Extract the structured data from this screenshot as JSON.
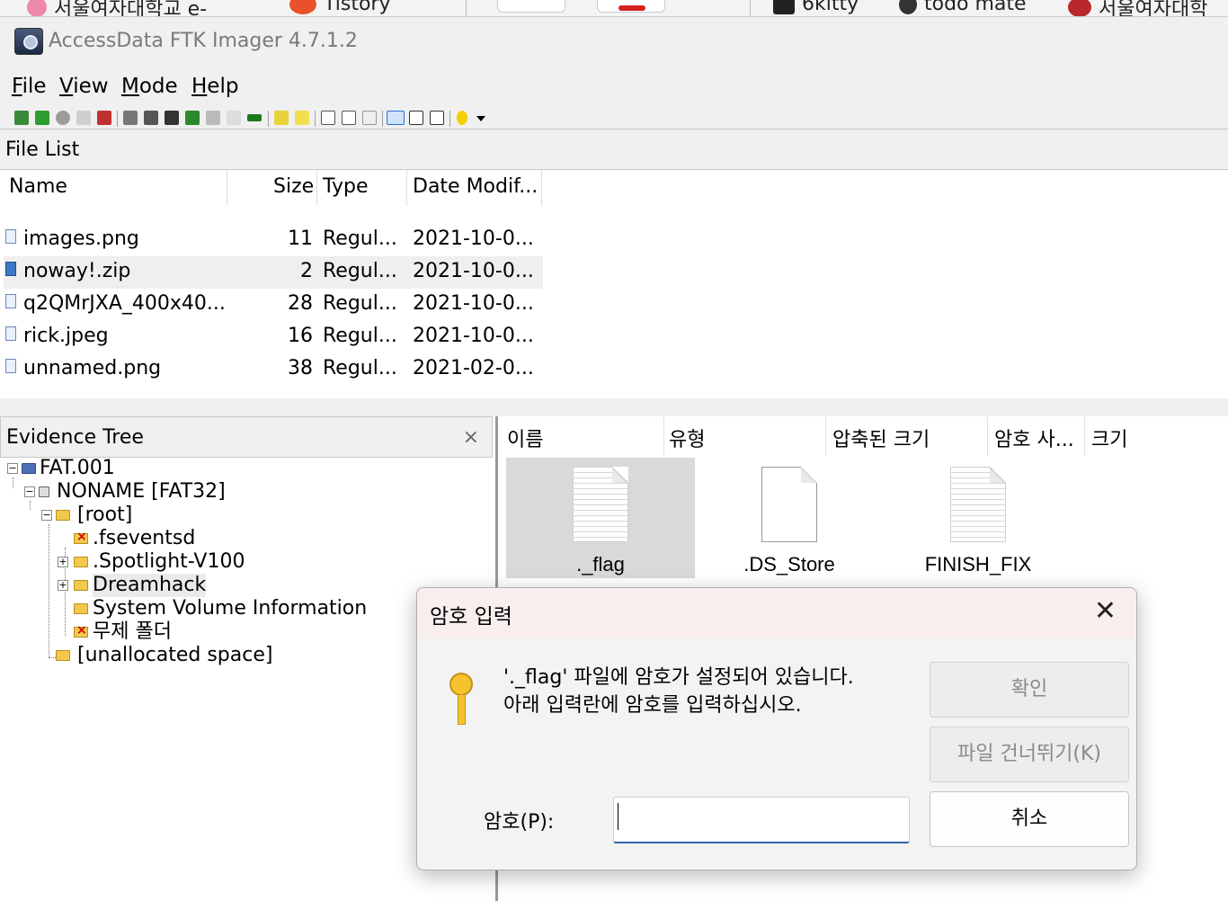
{
  "background_tabs": [
    "서울여자대학교 e-",
    "Tistory",
    "6kitty",
    "todo mate",
    "서울여자대학"
  ],
  "window": {
    "title": "AccessData FTK Imager 4.7.1.2"
  },
  "menu": {
    "items": [
      {
        "label": "File",
        "accel": "F"
      },
      {
        "label": "View",
        "accel": "V"
      },
      {
        "label": "Mode",
        "accel": "M"
      },
      {
        "label": "Help",
        "accel": "H"
      }
    ]
  },
  "toolbar": {
    "icons": [
      "add-evidence-icon",
      "add-all-evidence-icon",
      "image-mounting-icon",
      "remove-evidence-icon",
      "remove-all-evidence-icon",
      "create-image-icon",
      "export-disk-image-icon",
      "export-logical-image-icon",
      "capture-memory-icon",
      "obtain-protected-files-icon",
      "detect-encryption-icon",
      "ram-icon",
      "export-files-icon",
      "export-hash-list-icon",
      "export-directory-listing-icon",
      "file-icon",
      "properties-icon",
      "hex-value-icon",
      "auto-view-icon",
      "text-view-icon",
      "hex-view-icon",
      "help-icon",
      "dropdown-icon"
    ]
  },
  "file_list": {
    "title": "File List",
    "columns": [
      "Name",
      "Size",
      "Type",
      "Date Modif..."
    ],
    "rows": [
      {
        "name": "images.png",
        "size": "11",
        "type": "Regul...",
        "date": "2021-10-0..."
      },
      {
        "name": "noway!.zip",
        "size": "2",
        "type": "Regul...",
        "date": "2021-10-0..."
      },
      {
        "name": "q2QMrJXA_400x40...",
        "size": "28",
        "type": "Regul...",
        "date": "2021-10-0..."
      },
      {
        "name": "rick.jpeg",
        "size": "16",
        "type": "Regul...",
        "date": "2021-10-0..."
      },
      {
        "name": "unnamed.png",
        "size": "38",
        "type": "Regul...",
        "date": "2021-02-0..."
      }
    ]
  },
  "evidence_tree": {
    "title": "Evidence Tree",
    "close": "×",
    "nodes": [
      {
        "label": "FAT.001"
      },
      {
        "label": "NONAME [FAT32]"
      },
      {
        "label": "[root]"
      },
      {
        "label": ".fseventsd"
      },
      {
        "label": ".Spotlight-V100"
      },
      {
        "label": "Dreamhack"
      },
      {
        "label": "System Volume Information"
      },
      {
        "label": "무제 폴더"
      },
      {
        "label": "[unallocated space]"
      }
    ]
  },
  "explorer": {
    "columns": [
      "이름",
      "유형",
      "압축된 크기",
      "암호 사...",
      "크기"
    ],
    "items": [
      {
        "label": "._flag"
      },
      {
        "label": ".DS_Store"
      },
      {
        "label": "FINISH_FIX"
      }
    ]
  },
  "dialog": {
    "title": "암호 입력",
    "close": "✕",
    "message_line1": "'._flag' 파일에 암호가 설정되어 있습니다.",
    "message_line2": "아래 입력란에 암호를 입력하십시오.",
    "ok_label": "확인",
    "skip_label": "파일 건너뛰기(K)",
    "cancel_label": "취소",
    "password_label": "암호(P):",
    "password_value": ""
  }
}
